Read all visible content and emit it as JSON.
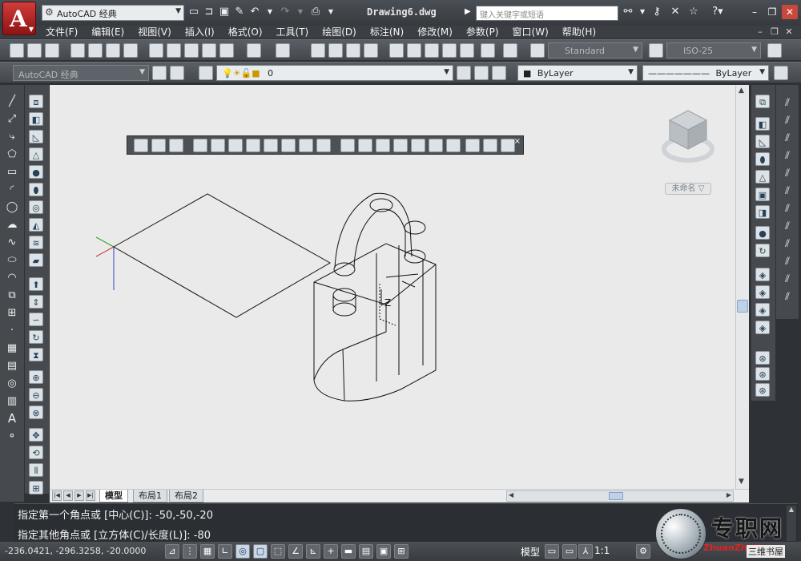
{
  "titlebar": {
    "workspace": "AutoCAD 经典",
    "document_title": "Drawing6.dwg",
    "search_placeholder": "键入关键字或短语"
  },
  "menubar": {
    "items": [
      {
        "label": "文件(F)"
      },
      {
        "label": "编辑(E)"
      },
      {
        "label": "视图(V)"
      },
      {
        "label": "插入(I)"
      },
      {
        "label": "格式(O)"
      },
      {
        "label": "工具(T)"
      },
      {
        "label": "绘图(D)"
      },
      {
        "label": "标注(N)"
      },
      {
        "label": "修改(M)"
      },
      {
        "label": "参数(P)"
      },
      {
        "label": "窗口(W)"
      },
      {
        "label": "帮助(H)"
      }
    ]
  },
  "toolbar": {
    "text_style": "Standard",
    "dim_style": "ISO-25",
    "workspace2": "AutoCAD 经典",
    "layer": "0",
    "color": "ByLayer",
    "linetype": "ByLayer"
  },
  "viewcube": {
    "view_name": "未命名"
  },
  "tabs": [
    {
      "label": "模型",
      "active": true
    },
    {
      "label": "布局1",
      "active": false
    },
    {
      "label": "布局2",
      "active": false
    }
  ],
  "command": {
    "line1": "指定第一个角点或 [中心(C)]: -50,-50,-20",
    "line2": "指定其他角点或 [立方体(C)/长度(L)]: -80"
  },
  "status": {
    "coords": "-236.0421, -296.3258, -20.0000",
    "model": "模型",
    "scale": "1:1"
  },
  "watermark": {
    "title": "专职网",
    "url": "ZhuanZhi.Net",
    "sub": "三维书屋"
  },
  "colors": {
    "titlebar": "#3e4247",
    "canvas": "#eaeaea",
    "accent_red": "#c9473c"
  }
}
